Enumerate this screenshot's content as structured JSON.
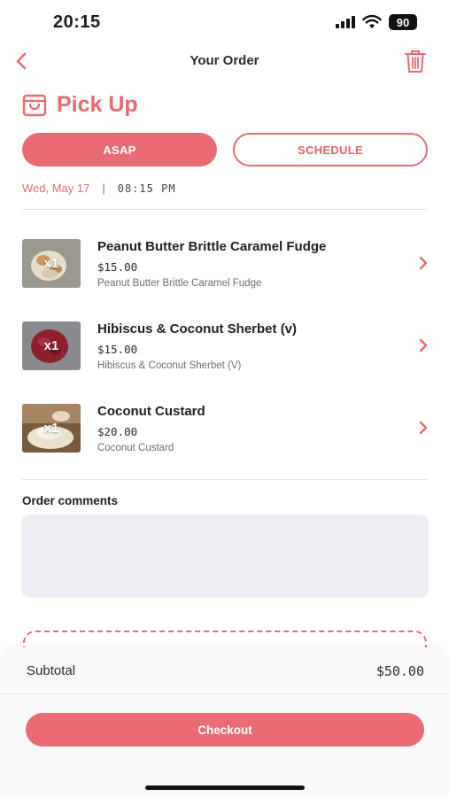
{
  "status_bar": {
    "time": "20:15",
    "battery": "90"
  },
  "header": {
    "title": "Your Order"
  },
  "order_type": {
    "label": "Pick Up"
  },
  "timing": {
    "asap_label": "ASAP",
    "schedule_label": "SCHEDULE",
    "date": "Wed, May 17",
    "separator": "|",
    "time": "08:15 PM"
  },
  "items": [
    {
      "quantity": "x1",
      "name": "Peanut Butter Brittle Caramel Fudge",
      "price": "$15.00",
      "description": "Peanut Butter Brittle Caramel Fudge"
    },
    {
      "quantity": "x1",
      "name": "Hibiscus & Coconut Sherbet (v)",
      "price": "$15.00",
      "description": "Hibiscus & Coconut Sherbet (V)"
    },
    {
      "quantity": "x1",
      "name": "Coconut Custard",
      "price": "$20.00",
      "description": "Coconut Custard"
    }
  ],
  "comments": {
    "label": "Order comments",
    "value": ""
  },
  "summary": {
    "subtotal_label": "Subtotal",
    "subtotal_value": "$50.00",
    "checkout_label": "Checkout"
  },
  "colors": {
    "accent": "#eb6b74",
    "comment_bg": "#ededf3"
  }
}
